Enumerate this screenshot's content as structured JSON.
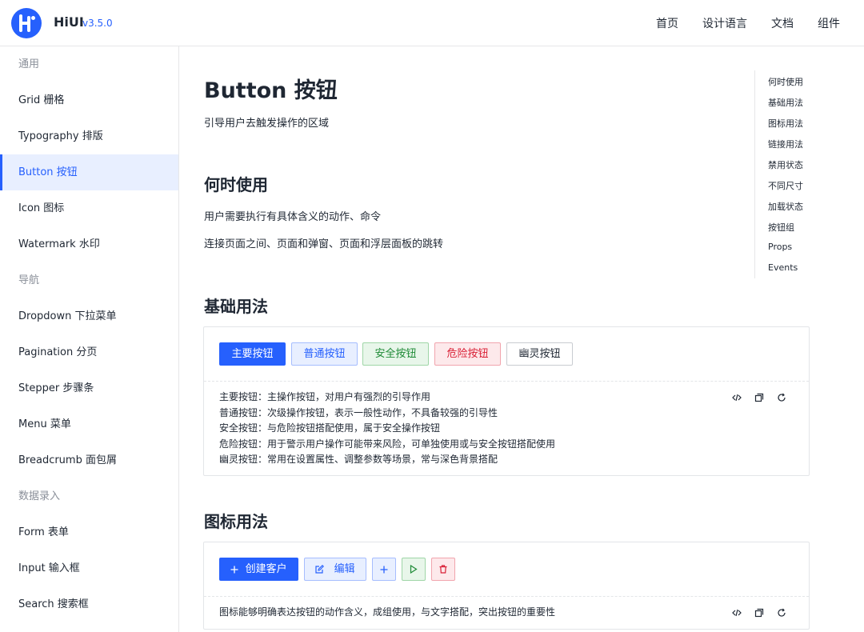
{
  "header": {
    "brand": "HiUI",
    "version": "v3.5.0",
    "nav": [
      "首页",
      "设计语言",
      "文档",
      "组件"
    ]
  },
  "sidebar": {
    "rows": [
      {
        "type": "group",
        "label": "通用"
      },
      {
        "type": "item",
        "label": "Grid 栅格"
      },
      {
        "type": "item",
        "label": "Typography 排版"
      },
      {
        "type": "item",
        "label": "Button 按钮",
        "active": true
      },
      {
        "type": "item",
        "label": "Icon 图标"
      },
      {
        "type": "item",
        "label": "Watermark 水印"
      },
      {
        "type": "group",
        "label": "导航"
      },
      {
        "type": "item",
        "label": "Dropdown 下拉菜单"
      },
      {
        "type": "item",
        "label": "Pagination 分页"
      },
      {
        "type": "item",
        "label": "Stepper 步骤条"
      },
      {
        "type": "item",
        "label": "Menu 菜单"
      },
      {
        "type": "item",
        "label": "Breadcrumb 面包屑"
      },
      {
        "type": "group",
        "label": "数据录入"
      },
      {
        "type": "item",
        "label": "Form 表单"
      },
      {
        "type": "item",
        "label": "Input 输入框"
      },
      {
        "type": "item",
        "label": "Search 搜索框"
      }
    ]
  },
  "page": {
    "title": "Button 按钮",
    "description": "引导用户去触发操作的区域"
  },
  "when_to_use": {
    "title": "何时使用",
    "lines": [
      "用户需要执行有具体含义的动作、命令",
      "连接页面之间、页面和弹窗、页面和浮层面板的跳转"
    ]
  },
  "basic": {
    "title": "基础用法",
    "buttons": [
      "主要按钮",
      "普通按钮",
      "安全按钮",
      "危险按钮",
      "幽灵按钮"
    ],
    "desc": [
      "主要按钮：主操作按钮，对用户有强烈的引导作用",
      "普通按钮：次级操作按钮，表示一般性动作，不具备较强的引导性",
      "安全按钮：与危险按钮搭配使用，属于安全操作按钮",
      "危险按钮：用于警示用户操作可能带来风险，可单独使用或与安全按钮搭配使用",
      "幽灵按钮：常用在设置属性、调整参数等场景，常与深色背景搭配"
    ]
  },
  "icon_usage": {
    "title": "图标用法",
    "create_label": "创建客户",
    "edit_label": "编辑",
    "desc": "图标能够明确表达按钮的动作含义，成组使用，与文字搭配，突出按钮的重要性"
  },
  "toc": [
    "何时使用",
    "基础用法",
    "图标用法",
    "链接用法",
    "禁用状态",
    "不同尺寸",
    "加载状态",
    "按钮组",
    "Props",
    "Events"
  ],
  "colors": {
    "primary": "#2660fd",
    "success": "#1e8a36",
    "danger": "#d91f35"
  }
}
